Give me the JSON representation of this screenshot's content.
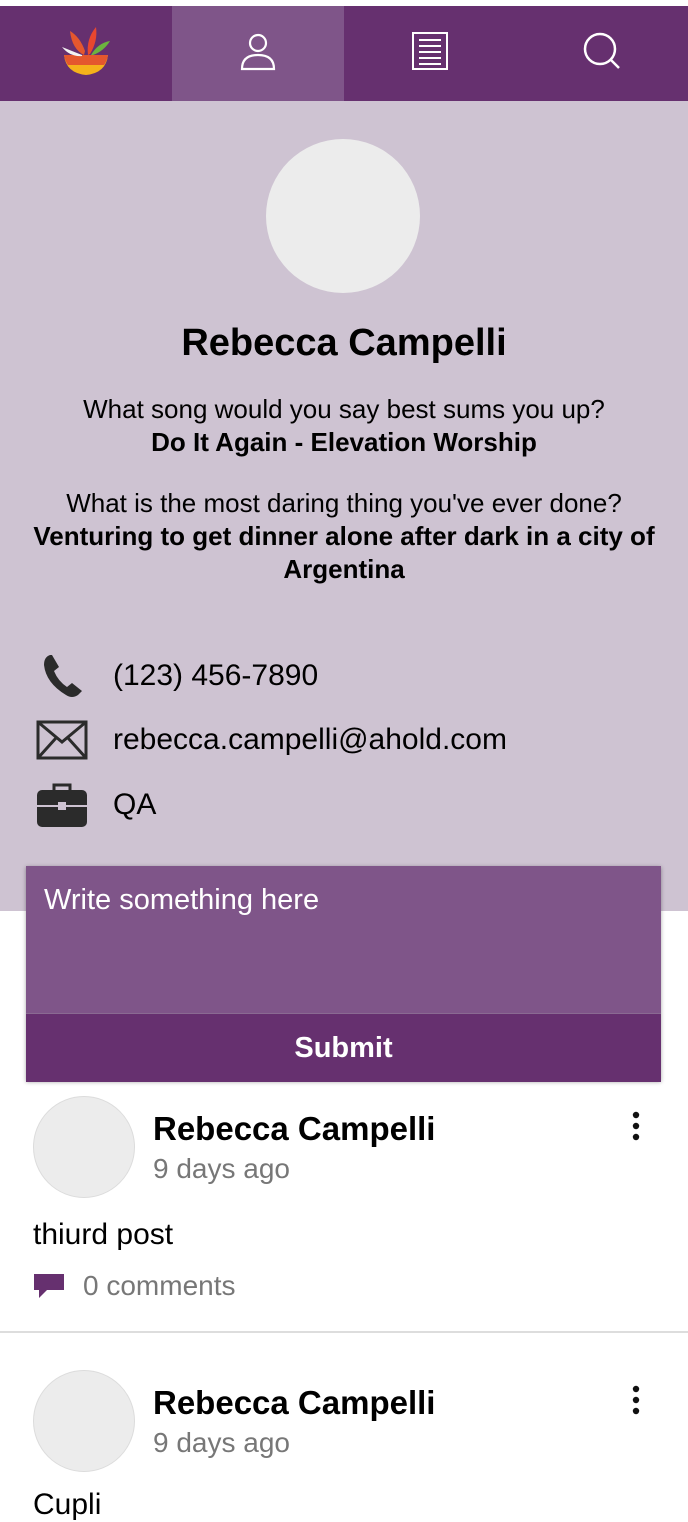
{
  "nav": {
    "items": [
      {
        "icon": "flower-bowl-logo-icon",
        "active": false
      },
      {
        "icon": "user-profile-icon",
        "active": true
      },
      {
        "icon": "document-list-icon",
        "active": false
      },
      {
        "icon": "search-icon",
        "active": false
      }
    ]
  },
  "profile": {
    "name": "Rebecca Campelli",
    "questions": [
      {
        "question": "What song would you say best sums you up?",
        "answer": "Do It Again - Elevation Worship"
      },
      {
        "question": "What is the most daring thing you've ever done?",
        "answer": "Venturing to get dinner alone after dark in a city of Argentina"
      }
    ],
    "contact": {
      "phone": "(123) 456-7890",
      "email": "rebecca.campelli@ahold.com",
      "department": "QA"
    }
  },
  "composer": {
    "placeholder": "Write something here",
    "submit_label": "Submit"
  },
  "posts": [
    {
      "author": "Rebecca Campelli",
      "time": "9 days ago",
      "text": "thiurd post",
      "comments": "0 comments"
    },
    {
      "author": "Rebecca Campelli",
      "time": "9 days ago",
      "text": "Cupli",
      "comments": ""
    }
  ],
  "colors": {
    "nav_bg": "#66306f",
    "nav_active": "#7f5589",
    "profile_bg": "#cec3d2",
    "composer_input": "#7f5589",
    "submit_bg": "#66306f"
  }
}
